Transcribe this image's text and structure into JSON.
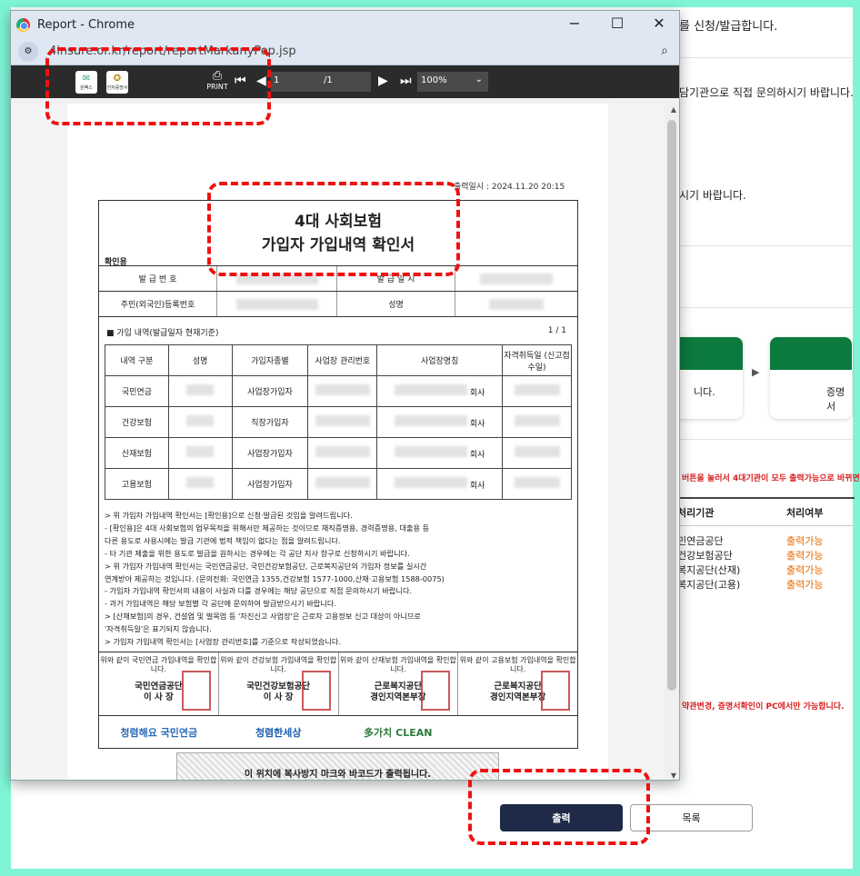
{
  "background": {
    "line1": "를 신청/발급합니다.",
    "line2": "담기관으로 직접 문의하시기 바랍니다.",
    "line3": "시기 바랍니다.",
    "step1_label": "니다.",
    "step2_label": "증명서",
    "red_note1": "버튼을 눌러서 4대기관이 모두 출력가능으로 바뀌면",
    "red_note2": "약관변경, 증명서확인이 PC에서만 가능합니다.",
    "table_headers": [
      "처리기관",
      "처리여부"
    ],
    "table_rows": [
      {
        "org": "민연금공단",
        "status": "출력가능"
      },
      {
        "org": "건강보험공단",
        "status": "출력가능"
      },
      {
        "org": "복지공단(산재)",
        "status": "출력가능"
      },
      {
        "org": "복지공단(고용)",
        "status": "출력가능"
      }
    ],
    "print_button": "출력",
    "list_button": "목록"
  },
  "window": {
    "title": "Report - Chrome",
    "url": "4insure.or.kr/report/reportMarkanyPop.jsp",
    "toolbar": {
      "icon1_label": "원팩스",
      "icon2_label": "전자증명서",
      "print_label": "PRINT",
      "page_current": "1",
      "page_total": "/1",
      "zoom": "100%"
    }
  },
  "document": {
    "issue_date": "출력일시 : 2024.11.20 20:15",
    "title_line1": "4대 사회보험",
    "title_line2": "가입자 가입내역 확인서",
    "confirm_label": "확인용",
    "issue_no_label": "발 급 번 호",
    "issue_date_label": "발 급 일 시",
    "id_label": "주민(외국인)등록번호",
    "name_label": "성명",
    "section_title": "■ 가입 내역(발급일자 현재기준)",
    "section_page": "1 / 1",
    "table_headers": [
      "내역 구분",
      "성명",
      "가입자종별",
      "사업장 관리번호",
      "사업장명칭",
      "자격취득일 (신고접수일)"
    ],
    "rows": [
      {
        "kind": "국민연금",
        "type": "사업장가입자",
        "company_suffix": "회사"
      },
      {
        "kind": "건강보험",
        "type": "직장가입자",
        "company_suffix": "회사"
      },
      {
        "kind": "산재보험",
        "type": "사업장가입자",
        "company_suffix": "회사"
      },
      {
        "kind": "고용보험",
        "type": "사업장가입자",
        "company_suffix": "회사"
      }
    ],
    "notes": [
      "> 위 가입자 가입내역 확인서는 [확인용]으로 신청·발급된 것임을 알려드립니다.",
      " - [확인용]은 4대 사회보험의 업무목적을 위해서만 제공하는 것이므로 재직증명용, 경력증명용, 대출용 등",
      "   다른 용도로 사용시에는 발급 기관에 법적 책임이 없다는 점을 알려드립니다.",
      " - 타 기관 제출을 위한 용도로 발급을 원하시는 경우에는 각 공단 지사 창구로 신청하시기 바랍니다.",
      "> 위 가입자 가입내역 확인서는 국민연금공단, 국민건강보험공단, 근로복지공단의 가입자 정보를 실시간",
      "   연계받아 제공하는 것입니다. (문의전화: 국민연금 1355,건강보험 1577-1000,산재·고용보험 1588-0075)",
      " - 가입자 가입내역 확인서의 내용이 사실과 다를 경우에는 해당 공단으로 직접 문의하시기 바랍니다.",
      " - 과거 가입내역은 해당 보험별 각 공단에 문의하여 발급받으시기 바랍니다.",
      "> [산재보험]의 경우, 건설업 및 벌목업 등 '자진신고 사업장'은 근로자 고용정보 신고 대상이 아니므로",
      "   '자격취득일'은 표기되지 않습니다.",
      "> 가입자 가입내역 확인서는 [사업장 관리번호]를 기준으로 작성되었습니다."
    ],
    "stamps": [
      {
        "text": "위와 같이 국민연금 가입내역을 확인합니다.",
        "org1": "국민연금공단",
        "org2": "이 사 장"
      },
      {
        "text": "위와 같이 건강보험 가입내역을 확인합니다.",
        "org1": "국민건강보험공단",
        "org2": "이 사 장"
      },
      {
        "text": "위와 같이 산재보험 가입내역을 확인합니다.",
        "org1": "근로복지공단",
        "org2": "경인지역본부장"
      },
      {
        "text": "위와 같이 고용보험 가입내역을 확인합니다.",
        "org1": "근로복지공단",
        "org2": "경인지역본부장"
      }
    ],
    "logos": [
      "청렴해요 국민연금",
      "청렴한세상",
      "多가치 CLEAN"
    ],
    "barcode_note": "이 위치에 복사방지 마크와 바코드가 출력됩니다."
  },
  "colors": {
    "highlight": "#e11",
    "green": "#0c7a3e",
    "dark_button": "#1e2a47",
    "status": "#e76a00"
  }
}
